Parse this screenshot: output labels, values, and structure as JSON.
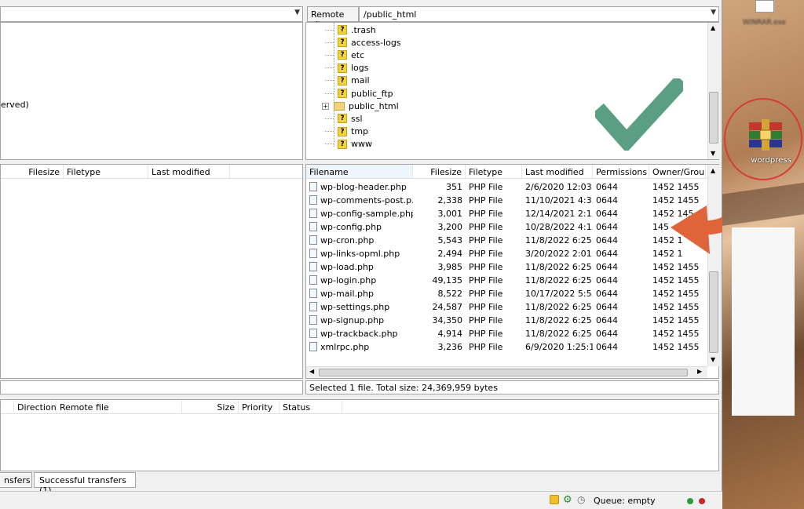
{
  "local": {
    "path_value": "",
    "tree_partial_text": "erved)",
    "columns": [
      "Filesize",
      "Filetype",
      "Last modified"
    ]
  },
  "remote": {
    "site_label": "Remote site:",
    "path_value": "/public_html",
    "tree": [
      {
        "name": ".trash",
        "icon": "unknown"
      },
      {
        "name": "access-logs",
        "icon": "unknown"
      },
      {
        "name": "etc",
        "icon": "unknown"
      },
      {
        "name": "logs",
        "icon": "unknown"
      },
      {
        "name": "mail",
        "icon": "unknown"
      },
      {
        "name": "public_ftp",
        "icon": "unknown"
      },
      {
        "name": "public_html",
        "icon": "folder",
        "expander": "+"
      },
      {
        "name": "ssl",
        "icon": "unknown"
      },
      {
        "name": "tmp",
        "icon": "unknown"
      },
      {
        "name": "www",
        "icon": "unknown"
      }
    ],
    "columns": [
      "Filename",
      "Filesize",
      "Filetype",
      "Last modified",
      "Permissions",
      "Owner/Group"
    ],
    "files": [
      {
        "name": "wp-blog-header.php",
        "size": "351",
        "type": "PHP File",
        "modified": "2/6/2020 12:03:...",
        "perm": "0644",
        "owner": "1452 1455"
      },
      {
        "name": "wp-comments-post.p...",
        "size": "2,338",
        "type": "PHP File",
        "modified": "11/10/2021 4:3...",
        "perm": "0644",
        "owner": "1452 1455"
      },
      {
        "name": "wp-config-sample.php",
        "size": "3,001",
        "type": "PHP File",
        "modified": "12/14/2021 2:1...",
        "perm": "0644",
        "owner": "1452 145"
      },
      {
        "name": "wp-config.php",
        "size": "3,200",
        "type": "PHP File",
        "modified": "10/28/2022 4:1...",
        "perm": "0644",
        "owner": "145"
      },
      {
        "name": "wp-cron.php",
        "size": "5,543",
        "type": "PHP File",
        "modified": "11/8/2022 6:25:...",
        "perm": "0644",
        "owner": "1452 1"
      },
      {
        "name": "wp-links-opml.php",
        "size": "2,494",
        "type": "PHP File",
        "modified": "3/20/2022 2:01:...",
        "perm": "0644",
        "owner": "1452 1"
      },
      {
        "name": "wp-load.php",
        "size": "3,985",
        "type": "PHP File",
        "modified": "11/8/2022 6:25:...",
        "perm": "0644",
        "owner": "1452 1455"
      },
      {
        "name": "wp-login.php",
        "size": "49,135",
        "type": "PHP File",
        "modified": "11/8/2022 6:25:...",
        "perm": "0644",
        "owner": "1452 1455"
      },
      {
        "name": "wp-mail.php",
        "size": "8,522",
        "type": "PHP File",
        "modified": "10/17/2022 5:5...",
        "perm": "0644",
        "owner": "1452 1455"
      },
      {
        "name": "wp-settings.php",
        "size": "24,587",
        "type": "PHP File",
        "modified": "11/8/2022 6:25:...",
        "perm": "0644",
        "owner": "1452 1455"
      },
      {
        "name": "wp-signup.php",
        "size": "34,350",
        "type": "PHP File",
        "modified": "11/8/2022 6:25:...",
        "perm": "0644",
        "owner": "1452 1455"
      },
      {
        "name": "wp-trackback.php",
        "size": "4,914",
        "type": "PHP File",
        "modified": "11/8/2022 6:25:...",
        "perm": "0644",
        "owner": "1452 1455"
      },
      {
        "name": "xmlrpc.php",
        "size": "3,236",
        "type": "PHP File",
        "modified": "6/9/2020 1:25:1...",
        "perm": "0644",
        "owner": "1452 1455"
      }
    ],
    "status_text": "Selected 1 file. Total size: 24,369,959 bytes"
  },
  "queue": {
    "columns": [
      "Direction",
      "Remote file",
      "Size",
      "Priority",
      "Status"
    ],
    "tabs": [
      "nsfers",
      "Successful transfers (1)"
    ],
    "status": "Queue: empty"
  },
  "desktop": {
    "rar_label": "wordpress",
    "top_icon_label": "WINRAR.exe"
  },
  "colors": {
    "check": "#5a9e84",
    "arrow": "#e0643a",
    "circle": "#d53c3c",
    "selected_row": "#cde8ff"
  }
}
